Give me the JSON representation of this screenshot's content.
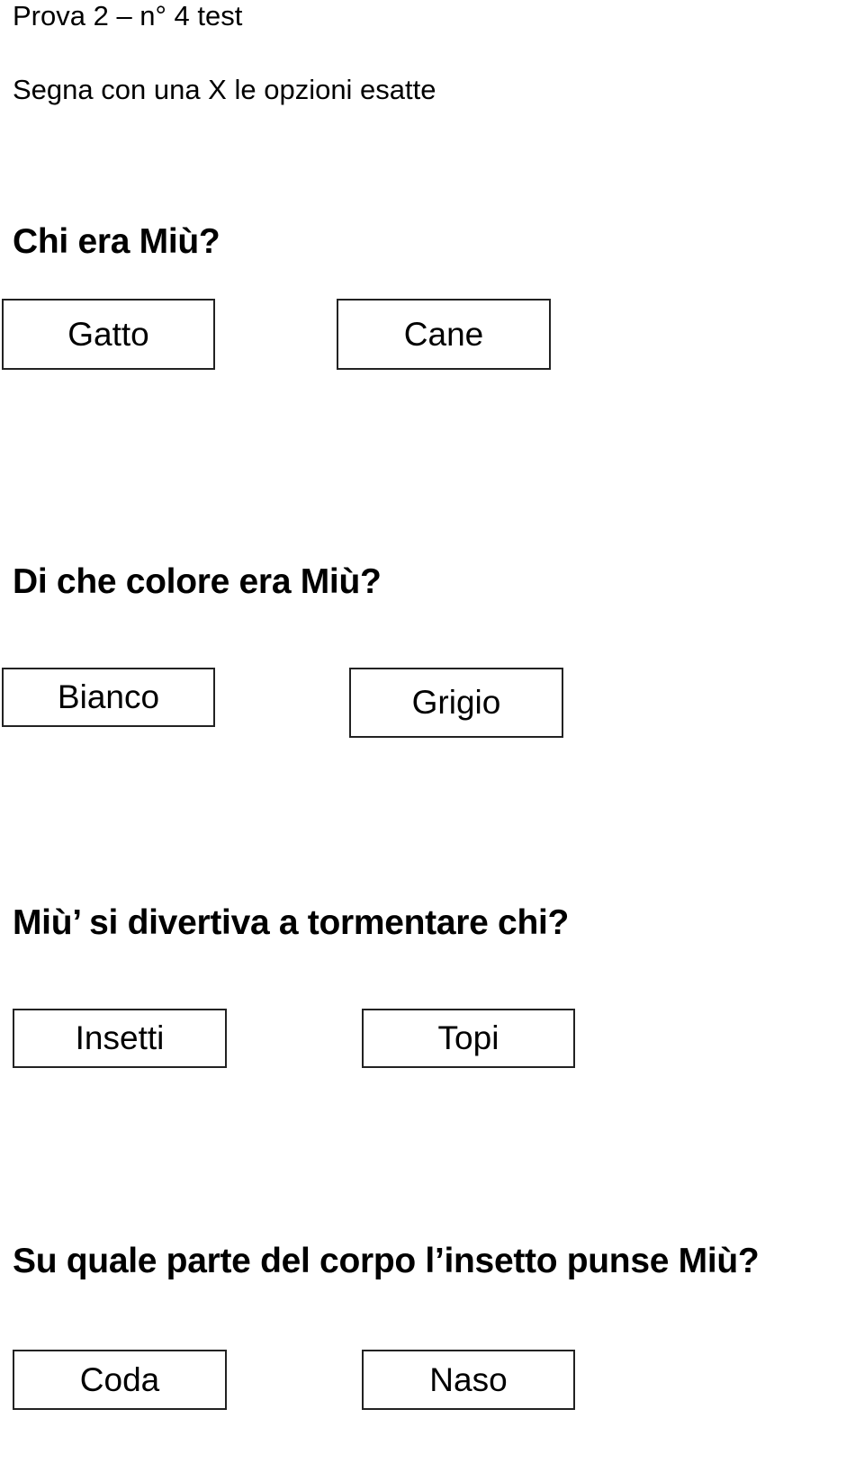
{
  "header": {
    "title": "Prova 2 – n° 4 test",
    "instruction": "Segna con una X le opzioni esatte"
  },
  "questions": [
    {
      "text": "Chi era Miù?",
      "options": [
        "Gatto",
        "Cane"
      ]
    },
    {
      "text": "Di che colore era Miù?",
      "options": [
        "Bianco",
        "Grigio"
      ]
    },
    {
      "text": "Miù’ si divertiva a tormentare chi?",
      "options": [
        "Insetti",
        "Topi"
      ]
    },
    {
      "text": "Su quale parte del corpo l’insetto punse Miù?",
      "options": [
        "Coda",
        "Naso"
      ]
    }
  ]
}
